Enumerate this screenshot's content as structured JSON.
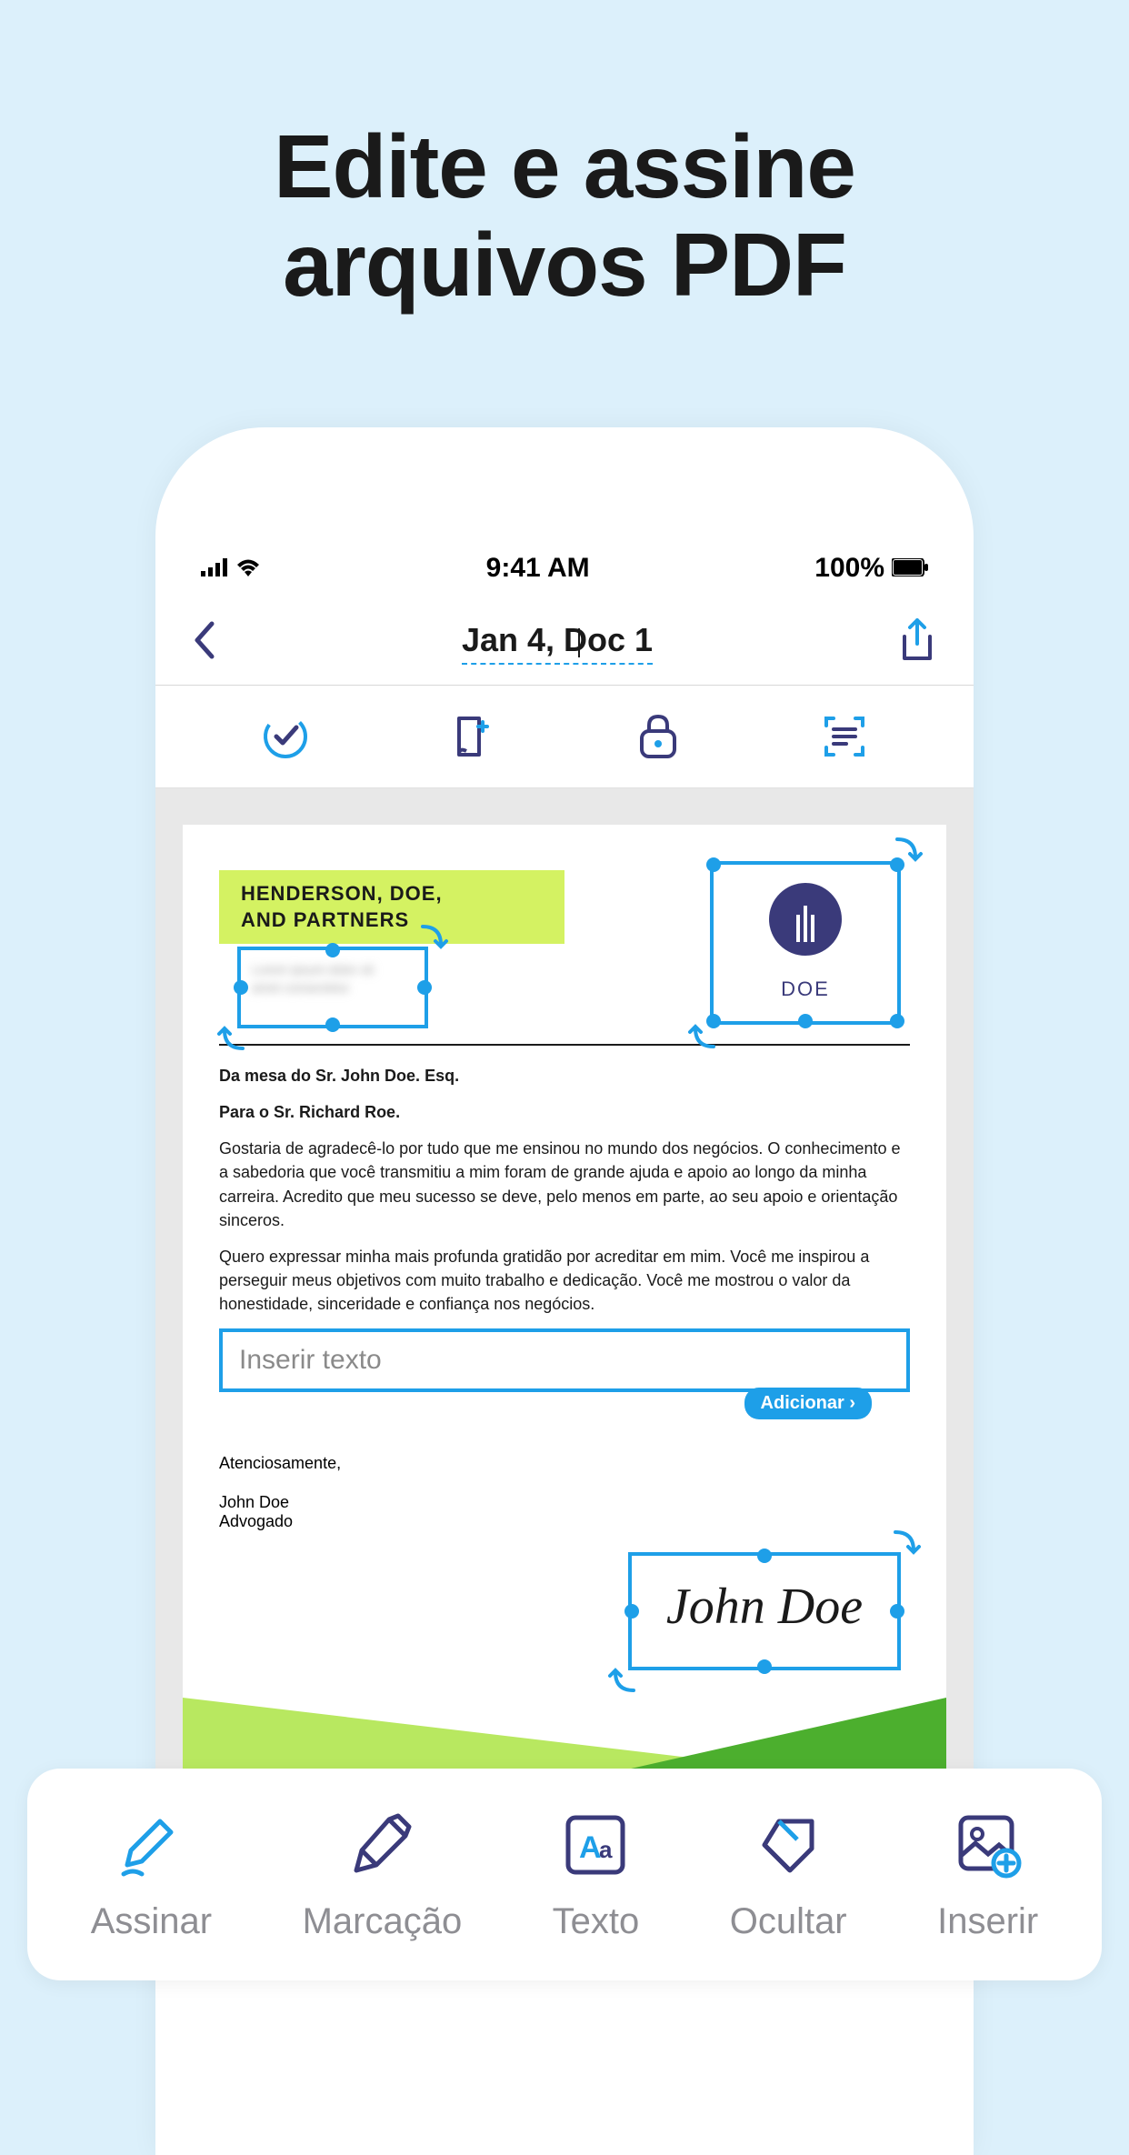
{
  "marketing": {
    "headline_line1": "Edite e assine",
    "headline_line2": "arquivos PDF"
  },
  "status": {
    "time": "9:41 AM",
    "battery": "100%"
  },
  "nav": {
    "doc_title": "Jan 4, Doc 1"
  },
  "document": {
    "org_name_line1": "HENDERSON, DOE,",
    "org_name_line2": "AND PARTNERS",
    "logo_label": "DOE",
    "from": "Da mesa do Sr. John Doe. Esq.",
    "to": "Para o Sr. Richard Roe.",
    "para1": "Gostaria de agradecê-lo por tudo que me ensinou no mundo dos negócios. O conhecimento e a sabedoria que você transmitiu a mim foram de grande ajuda e apoio ao longo da minha carreira. Acredito que meu sucesso se deve, pelo menos em parte, ao seu apoio e orientação sinceros.",
    "para2": "Quero expressar minha mais profunda gratidão por acreditar em mim. Você me inspirou a perseguir meus objetivos com muito trabalho e dedicação. Você me mostrou o valor da honestidade, sinceridade e confiança nos negócios.",
    "text_placeholder": "Inserir texto",
    "add_button": "Adicionar ›",
    "closing": "Atenciosamente,",
    "signer_name": "John Doe",
    "signer_title": "Advogado",
    "signature": "John Doe"
  },
  "bottom_bar": {
    "sign": "Assinar",
    "markup": "Marcação",
    "text": "Texto",
    "hide": "Ocultar",
    "insert": "Inserir"
  },
  "colors": {
    "accent": "#1e9fe8",
    "highlight": "#d4f262",
    "navy": "#3a3a7a"
  }
}
